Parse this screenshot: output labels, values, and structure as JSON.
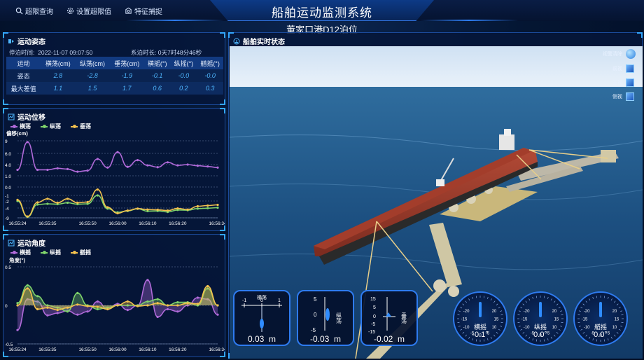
{
  "header": {
    "title": "船舶运动监测系统",
    "subtitle": "董家口港D12泊位",
    "nav": [
      {
        "label": "超限查询",
        "icon": "search-icon"
      },
      {
        "label": "设置超限值",
        "icon": "gear-icon"
      },
      {
        "label": "特征捕捉",
        "icon": "capture-icon"
      }
    ]
  },
  "attitude": {
    "title": "运动姿态",
    "stop_time_label": "停泊时间:",
    "stop_time": "2022-11-07 09:07:50",
    "moor_label": "系泊时长:",
    "moor_duration": "0天7时48分46秒",
    "headers": [
      "运动",
      "横荡(cm)",
      "纵荡(cm)",
      "垂荡(cm)",
      "横摇(°)",
      "纵摇(°)",
      "艏摇(°)"
    ],
    "rows": [
      [
        "姿态",
        "2.8",
        "-2.8",
        "-1.9",
        "-0.1",
        "-0.0",
        "-0.0"
      ],
      [
        "最大差值",
        "1.1",
        "1.5",
        "1.7",
        "0.6",
        "0.2",
        "0.3"
      ]
    ]
  },
  "displacement": {
    "title": "运动位移",
    "legend": [
      "横荡",
      "纵荡",
      "垂荡"
    ],
    "ylabel": "偏移(cm)",
    "yticks": [
      "9",
      "6.0",
      "4.0",
      "1.0",
      "0.0",
      "-1",
      "-2",
      "-4",
      "-9"
    ]
  },
  "angle": {
    "title": "运动角度",
    "legend": [
      "横摇",
      "纵摇",
      "艏摇"
    ],
    "ylabel": "角度(°)",
    "yticks": [
      "0.5",
      "0",
      "-0.5"
    ]
  },
  "chart_data": [
    {
      "type": "line",
      "title": "运动位移",
      "ylabel": "偏移(cm)",
      "x": [
        "16:55:24",
        "16:55:28",
        "16:55:31",
        "16:55:35",
        "16:55:39",
        "16:55:43",
        "16:55:47",
        "16:55:50",
        "16:55:54",
        "16:55:58",
        "16:56:00",
        "16:56:04",
        "16:56:07",
        "16:56:10",
        "16:56:14",
        "16:56:17",
        "16:56:20",
        "16:56:24",
        "16:56:28",
        "16:56:31",
        "16:56:34"
      ],
      "xticks": [
        "16:55:24",
        "16:55:35",
        "16:55:50",
        "16:56:00",
        "16:56:10",
        "16:56:20",
        "16:56:34"
      ],
      "series": [
        {
          "name": "横荡",
          "color": "#b06ad9",
          "values": [
            2.6,
            8.7,
            2.6,
            2.6,
            3.0,
            2.8,
            2.1,
            2.4,
            5.0,
            3.2,
            6.3,
            3.4,
            4.8,
            3.8,
            3.3,
            4.4,
            3.8,
            4.0,
            3.7,
            3.5,
            3.2
          ]
        },
        {
          "name": "纵荡",
          "color": "#7fd36b",
          "values": [
            -2.0,
            -8.5,
            -3.0,
            -2.8,
            -2.9,
            -2.5,
            -2.9,
            -2.8,
            -1.0,
            -4.3,
            -6.2,
            -5.5,
            -4.4,
            -5.6,
            -5.5,
            -6.0,
            -5.0,
            -5.1,
            -4.3,
            -4.1,
            -3.9
          ]
        },
        {
          "name": "垂荡",
          "color": "#f2c14e",
          "values": [
            -1.8,
            -8.3,
            -2.4,
            -1.6,
            -2.5,
            -1.6,
            -2.5,
            -2.3,
            -0.3,
            -3.8,
            -6.7,
            -5.3,
            -4.3,
            -4.8,
            -4.9,
            -5.3,
            -4.2,
            -4.8,
            -3.5,
            -3.3,
            -3.1
          ]
        }
      ]
    },
    {
      "type": "area",
      "title": "运动角度",
      "ylabel": "角度(°)",
      "ylim": [
        -0.5,
        0.5
      ],
      "x": [
        "16:55:24",
        "16:55:28",
        "16:55:31",
        "16:55:35",
        "16:55:39",
        "16:55:43",
        "16:55:47",
        "16:55:50",
        "16:55:54",
        "16:55:58",
        "16:56:00",
        "16:56:04",
        "16:56:07",
        "16:56:10",
        "16:56:14",
        "16:56:17",
        "16:56:20",
        "16:56:24",
        "16:56:28",
        "16:56:31",
        "16:56:34"
      ],
      "xticks": [
        "16:55:24",
        "16:55:35",
        "16:55:50",
        "16:56:00",
        "16:56:10",
        "16:56:20",
        "16:56:34"
      ],
      "series": [
        {
          "name": "横摇",
          "color": "#b06ad9",
          "values": [
            -0.32,
            0.08,
            0.05,
            -0.13,
            -0.1,
            -0.07,
            -0.12,
            -0.08,
            0.05,
            -0.05,
            0.02,
            -0.06,
            0.0,
            0.33,
            -0.15,
            -0.05,
            -0.08,
            0.0,
            0.1,
            0.08,
            -0.12
          ]
        },
        {
          "name": "纵摇",
          "color": "#7fd36b",
          "values": [
            0.03,
            0.26,
            0.12,
            0.0,
            -0.03,
            -0.08,
            0.16,
            0.0,
            -0.05,
            -0.03,
            0.0,
            0.0,
            0.0,
            0.05,
            0.08,
            0.0,
            0.04,
            0.04,
            0.0,
            0.22,
            0.0
          ]
        },
        {
          "name": "艏摇",
          "color": "#f2c14e",
          "values": [
            0.0,
            0.22,
            -0.05,
            -0.03,
            -0.06,
            -0.03,
            0.01,
            -0.01,
            -0.02,
            -0.05,
            0.0,
            0.05,
            -0.01,
            0.0,
            0.03,
            0.0,
            0.0,
            0.03,
            0.02,
            0.25,
            0.0
          ]
        }
      ]
    }
  ],
  "realtime": {
    "title": "船舶实时状态",
    "views": [
      "视警清除",
      "前视",
      "主视",
      "侧视"
    ],
    "sway_label": "横荡",
    "surge_label": "纵荡",
    "heave_label": "垂荡",
    "sway_value": "0.03",
    "surge_value": "-0.03",
    "heave_value": "-0.02",
    "unit": "m",
    "roll_label": "横摇",
    "pitch_label": "纵摇",
    "yaw_label": "艏摇",
    "roll_value": "-0.1°",
    "pitch_value": "0.0°",
    "yaw_value": "0.0°",
    "gauge_h_ticks": [
      "-1",
      "0",
      "1"
    ],
    "gauge_v_ticks_small": [
      "5",
      "0",
      "-5"
    ],
    "gauge_v_ticks_large": [
      "15",
      "5",
      "0",
      "-5",
      "-15"
    ],
    "dial_ticks": [
      "-10",
      "-5",
      "0",
      "5",
      "10",
      "-15",
      "15",
      "-20",
      "20"
    ]
  }
}
